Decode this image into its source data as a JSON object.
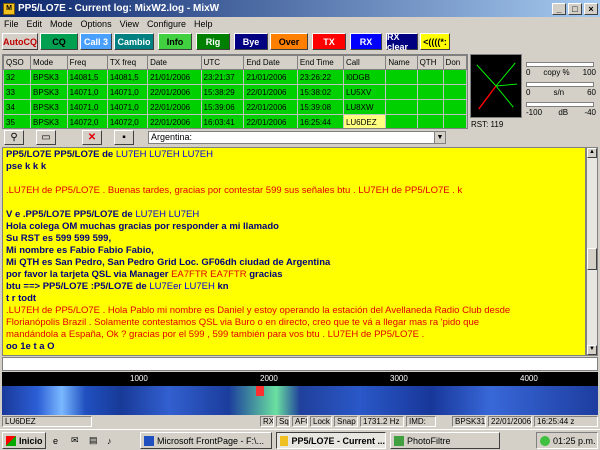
{
  "window": {
    "title": "PP5/LO7E - Current log: MixW2.log - MixW",
    "icon": "mixw-app-icon"
  },
  "menu": [
    "File",
    "Edit",
    "Mode",
    "Options",
    "View",
    "Configure",
    "Help"
  ],
  "macros": [
    {
      "label": "AutoCQ",
      "bg": "#d4d0c8",
      "fg": "#c00000"
    },
    {
      "label": "CQ",
      "bg": "#00a050",
      "fg": "#000000"
    },
    {
      "label": "Call 3",
      "bg": "#4aa0ff",
      "fg": "#ffffff"
    },
    {
      "label": "Cambio",
      "bg": "#008080",
      "fg": "#ffffff"
    },
    {
      "label": "Info",
      "bg": "#40d040",
      "fg": "#000000"
    },
    {
      "label": "Rig",
      "bg": "#008000",
      "fg": "#ffffff"
    },
    {
      "label": "Bye",
      "bg": "#000080",
      "fg": "#ffffff"
    },
    {
      "label": "Over",
      "bg": "#ff8000",
      "fg": "#000000"
    },
    {
      "label": "TX",
      "bg": "#ff0000",
      "fg": "#ffffff"
    },
    {
      "label": "RX",
      "bg": "#0000ff",
      "fg": "#ffffff"
    },
    {
      "label": "RX clear",
      "bg": "#000080",
      "fg": "#ffffff"
    },
    {
      "label": "<((((*:",
      "bg": "#ffff00",
      "fg": "#000000"
    }
  ],
  "qso": {
    "columns": [
      "QSO",
      "Mode",
      "Freq",
      "TX freq",
      "Date",
      "UTC",
      "End Date",
      "End Time",
      "Call",
      "Name",
      "QTH",
      "Don"
    ],
    "rows": [
      [
        "32",
        "BPSK3",
        "14081,5",
        "14081,5",
        "21/01/2006",
        "23:21:37",
        "21/01/2006",
        "23:26:22",
        "I0DGB",
        "",
        "",
        ""
      ],
      [
        "33",
        "BPSK3",
        "14071,0",
        "14071,0",
        "22/01/2006",
        "15:38:29",
        "22/01/2006",
        "15:38:02",
        "LU5XV",
        "",
        "",
        ""
      ],
      [
        "34",
        "BPSK3",
        "14071,0",
        "14071,0",
        "22/01/2006",
        "15:39:06",
        "22/01/2006",
        "15:39:08",
        "LU8XW",
        "",
        "",
        ""
      ],
      [
        "35",
        "BPSK3",
        "14072,0",
        "14072,0",
        "22/01/2006",
        "16:03:41",
        "22/01/2006",
        "16:25:44",
        "LU6DEZ",
        "",
        "",
        ""
      ]
    ]
  },
  "meters": {
    "copy_label": "copy %",
    "copy_min": "0",
    "copy_max": "100",
    "sn_label": "s/n",
    "sn_min": "0",
    "sn_max": "60",
    "db_label": "dB",
    "db_min": "-100",
    "db_max": "-40",
    "rst": "RST: 119"
  },
  "toolbar2": {
    "country": "Argentina:"
  },
  "rx_lines": [
    [
      {
        "t": "PP5/LO7E PP5/LO7E de ",
        "c": "b"
      },
      {
        "t": "LU7EH LU7EH LU7EH",
        "c": "bl"
      }
    ],
    [
      {
        "t": " pse k k k",
        "c": "b"
      }
    ],
    [
      {
        "t": "",
        "c": "b"
      }
    ],
    [
      {
        "t": " .LU7EH de PP5/LO7E .   Buenas tardes, gracias por contestar 599 sus señales btu . LU7EH de PP5/LO7E .   k",
        "c": "r"
      }
    ],
    [
      {
        "t": "",
        "c": "b"
      }
    ],
    [
      {
        "t": "V e  .PP5/LO7E PP5/LO7E de ",
        "c": "b"
      },
      {
        "t": "LU7EH LU7EH",
        "c": "bl"
      }
    ],
    [
      {
        "t": "Hola colega OM muchas gracias por responder a mi llamado",
        "c": "b"
      }
    ],
    [
      {
        "t": "Su RST es  599  599  599,",
        "c": "b"
      }
    ],
    [
      {
        "t": "Mi nombre es  Fabio  Fabio  Fabio,",
        "c": "b"
      }
    ],
    [
      {
        "t": "Mi QTH es  San Pedro, San Pedro  Grid Loc. GF06dh ciudad de Argentina",
        "c": "b"
      }
    ],
    [
      {
        "t": "por favor la tarjeta QSL via Manager ",
        "c": "b"
      },
      {
        "t": "EA7FTR  EA7FTR",
        "c": "r"
      },
      {
        "t": " gracias",
        "c": "b"
      }
    ],
    [
      {
        "t": "btu ==> PP5/LO7E :P5/LO7E de ",
        "c": "b"
      },
      {
        "t": "LU7Eer LU7EH",
        "c": "bl"
      },
      {
        "t": " kn",
        "c": "b"
      }
    ],
    [
      {
        "t": "  t  r todt",
        "c": "b"
      }
    ],
    [
      {
        "t": " .LU7EH de PP5/LO7E .   Hola Pablo mi nombre es Daniel y estoy operando la estación del Avellaneda Radio Club desde",
        "c": "r"
      }
    ],
    [
      {
        "t": "Florianópolis Brazil      . Solamente contestamos QSL via Buro o en directo, creo que te vá a llegar mas ra 'pido que",
        "c": "r"
      }
    ],
    [
      {
        "t": "mandándola a España, Ok ?   gracias por el 599 , 599 también para vos btu . LU7EH de PP5/LO7E .",
        "c": "r"
      }
    ],
    [
      {
        "t": " oo  1e  t a  O",
        "c": "b"
      }
    ]
  ],
  "ruler_ticks": [
    "1000",
    "2000",
    "3000",
    "4000"
  ],
  "status": [
    "LU6DEZ",
    "RX",
    "Sq",
    "AFC",
    "Lock",
    "Snap",
    "1731.2 Hz",
    "IMD:",
    "BPSK31",
    "22/01/2006",
    "16:25:44 z"
  ],
  "taskbar": {
    "start": "Inicio",
    "tasks": [
      "Microsoft FrontPage - F:\\...",
      "PP5/LO7E - Current ...",
      "PhotoFiltre"
    ],
    "clock": "01:25 p.m."
  }
}
